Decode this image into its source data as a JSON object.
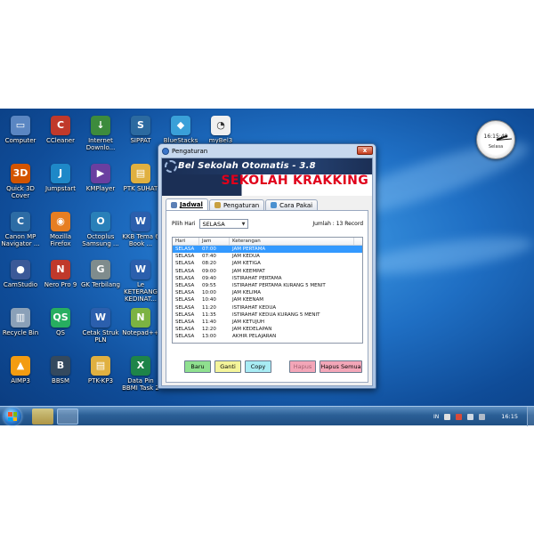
{
  "desktop": {
    "icons": [
      {
        "label": "Computer",
        "glyph": "▭",
        "color": "#5a86c2"
      },
      {
        "label": "CCleaner",
        "glyph": "C",
        "color": "#c0392b"
      },
      {
        "label": "Internet Downlo...",
        "glyph": "↓",
        "color": "#3d8b3d"
      },
      {
        "label": "SIPPAT",
        "glyph": "S",
        "color": "#2c6aa0"
      },
      {
        "label": "BlueStacks",
        "glyph": "◆",
        "color": "#3aa0d8"
      },
      {
        "label": "myBel3",
        "glyph": "◔",
        "color": "#f0f0f0"
      },
      {
        "label": "Quick 3D Cover",
        "glyph": "3D",
        "color": "#d35400"
      },
      {
        "label": "Jumpstart",
        "glyph": "J",
        "color": "#1e88c8"
      },
      {
        "label": "KMPlayer",
        "glyph": "▶",
        "color": "#6a3fa0"
      },
      {
        "label": "PTK SUHAT",
        "glyph": "▤",
        "color": "#e0b040"
      },
      {
        "label": "Canon MP Navigator ...",
        "glyph": "C",
        "color": "#2d6ca5"
      },
      {
        "label": "Mozilla Firefox",
        "glyph": "◉",
        "color": "#e67e22"
      },
      {
        "label": "Octoplus Samsung ...",
        "glyph": "O",
        "color": "#2980b9"
      },
      {
        "label": "KKB Tema 6 Book ...",
        "glyph": "W",
        "color": "#2b5fad"
      },
      {
        "label": "CamStudio",
        "glyph": "●",
        "color": "#3b5998"
      },
      {
        "label": "Nero Pro 9",
        "glyph": "N",
        "color": "#c0392b"
      },
      {
        "label": "GK Terbilang",
        "glyph": "G",
        "color": "#7f8c8d"
      },
      {
        "label": "Le KETERANG KEDINAT...",
        "glyph": "W",
        "color": "#2b5fad"
      },
      {
        "label": "Recycle Bin",
        "glyph": "▥",
        "color": "#8aa0b8"
      },
      {
        "label": "QS",
        "glyph": "QS",
        "color": "#27ae60"
      },
      {
        "label": "Cetak Struk PLN",
        "glyph": "W",
        "color": "#2b5fad"
      },
      {
        "label": "Notepad++",
        "glyph": "N",
        "color": "#7cb342"
      },
      {
        "label": "AIMP3",
        "glyph": "▲",
        "color": "#f39c12"
      },
      {
        "label": "BBSM",
        "glyph": "B",
        "color": "#34495e"
      },
      {
        "label": "PTK-KP3",
        "glyph": "▤",
        "color": "#e0b040"
      },
      {
        "label": "Data Pin BBMI Task 2",
        "glyph": "X",
        "color": "#1e8449"
      }
    ]
  },
  "clock": {
    "time": "16:15:40",
    "city": "Selasa"
  },
  "window": {
    "title": "Pengaturan",
    "close_label": "x",
    "app_title": "Bel Sekolah Otomatis - 3.8",
    "school_name": "SEKOLAH KRAKKING",
    "tabs": [
      {
        "label": "Jadwal",
        "active": true,
        "icon_color": "#5b7fb5"
      },
      {
        "label": "Pengaturan",
        "active": false,
        "icon_color": "#c8a040"
      },
      {
        "label": "Cara Pakai",
        "active": false,
        "icon_color": "#4a90d0"
      }
    ],
    "pilih_hari_label": "Pilih Hari",
    "hari_selected": "SELASA",
    "jumlah": "Jumlah : 13 Record",
    "columns": [
      "Hari",
      "Jam",
      "Keterangan"
    ],
    "rows": [
      {
        "hari": "SELASA",
        "jam": "07:00",
        "ket": "JAM PERTAMA",
        "selected": true
      },
      {
        "hari": "SELASA",
        "jam": "07:40",
        "ket": "JAM KEDUA"
      },
      {
        "hari": "SELASA",
        "jam": "08:20",
        "ket": "JAM KETIGA"
      },
      {
        "hari": "SELASA",
        "jam": "09:00",
        "ket": "JAM KEEMPAT"
      },
      {
        "hari": "SELASA",
        "jam": "09:40",
        "ket": "ISTIRAHAT PERTAMA"
      },
      {
        "hari": "SELASA",
        "jam": "09:55",
        "ket": "ISTIRAHAT PERTAMA KURANG 5 MENIT"
      },
      {
        "hari": "SELASA",
        "jam": "10:00",
        "ket": "JAM KELIMA"
      },
      {
        "hari": "SELASA",
        "jam": "10:40",
        "ket": "JAM KEENAM"
      },
      {
        "hari": "SELASA",
        "jam": "11:20",
        "ket": "ISTIRAHAT KEDUA"
      },
      {
        "hari": "SELASA",
        "jam": "11:35",
        "ket": "ISTIRAHAT KEDUA KURANG 5 MENIT"
      },
      {
        "hari": "SELASA",
        "jam": "11:40",
        "ket": "JAM KETUJUH"
      },
      {
        "hari": "SELASA",
        "jam": "12:20",
        "ket": "JAM KEDELAPAN"
      },
      {
        "hari": "SELASA",
        "jam": "13:00",
        "ket": "AKHIR PELAJARAN"
      }
    ],
    "buttons": [
      {
        "label": "Baru",
        "color": "#8fe08f",
        "enabled": true,
        "name": "baru-button"
      },
      {
        "label": "Ganti",
        "color": "#f4f49a",
        "enabled": true,
        "name": "ganti-button"
      },
      {
        "label": "Copy",
        "color": "#a8ecf4",
        "enabled": true,
        "name": "copy-button"
      },
      {
        "label": "Hapus",
        "color": "#f3a6b8",
        "enabled": false,
        "name": "hapus-button"
      },
      {
        "label": "Hapus Semua",
        "color": "#f3a6b8",
        "enabled": true,
        "name": "hapus-semua-button"
      }
    ]
  },
  "taskbar": {
    "language": "IN",
    "time": "16:15"
  }
}
